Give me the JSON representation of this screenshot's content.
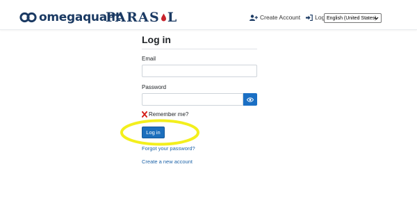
{
  "header": {
    "brand": "omegaquant",
    "partner": {
      "before": "PARAS",
      "after": "L"
    },
    "nav": {
      "create_account": "Create Account",
      "log_in": "Log in"
    },
    "language": {
      "selected": "English (United States)"
    }
  },
  "form": {
    "title": "Log in",
    "email_label": "Email",
    "email_value": "",
    "password_label": "Password",
    "password_value": "",
    "remember_label": "Remember me?",
    "remember_checked": false,
    "login_button": "Log in",
    "forgot_link": "Forgot your password?",
    "register_link": "Create a new account"
  },
  "colors": {
    "brand": "#1b3a63",
    "primary": "#1c6fbd",
    "link": "#1d63a8",
    "highlight": "#f3ef1d",
    "mark": "#d6201b"
  },
  "icons": [
    "logo-icon",
    "drop-icon",
    "add-user-icon",
    "sign-in-icon",
    "chevron-down-icon",
    "eye-icon",
    "x-mark-icon"
  ]
}
